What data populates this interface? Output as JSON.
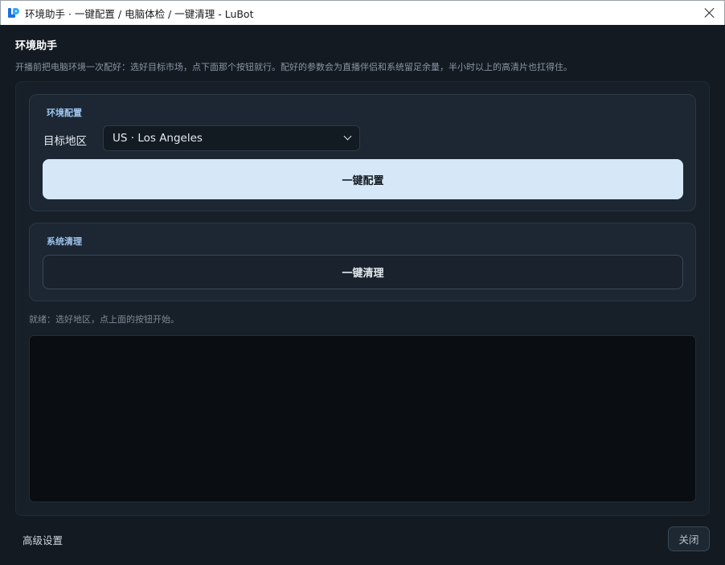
{
  "window": {
    "title": "环境助手 · 一键配置 / 电脑体检 / 一键清理 - LuBot"
  },
  "header": {
    "title": "环境助手",
    "description": "开播前把电脑环境一次配好：选好目标市场，点下面那个按钮就行。配好的参数会为直播伴侣和系统留足余量，半小时以上的高清片也扛得住。"
  },
  "env_config": {
    "title": "环境配置",
    "region_label": "目标地区",
    "region_selected": "US · Los Angeles",
    "button_label": "一键配置"
  },
  "system_clean": {
    "title": "系统清理",
    "button_label": "一键清理"
  },
  "status": {
    "text": "就绪：选好地区，点上面的按钮开始。"
  },
  "log": {
    "content": ""
  },
  "footer": {
    "advanced_label": "高级设置",
    "close_label": "关闭"
  },
  "colors": {
    "background": "#131a22",
    "card": "#1c2733",
    "accent_title": "#9ec5ee",
    "primary_button": "#d6e8f7",
    "log_background": "#0a0d11"
  }
}
